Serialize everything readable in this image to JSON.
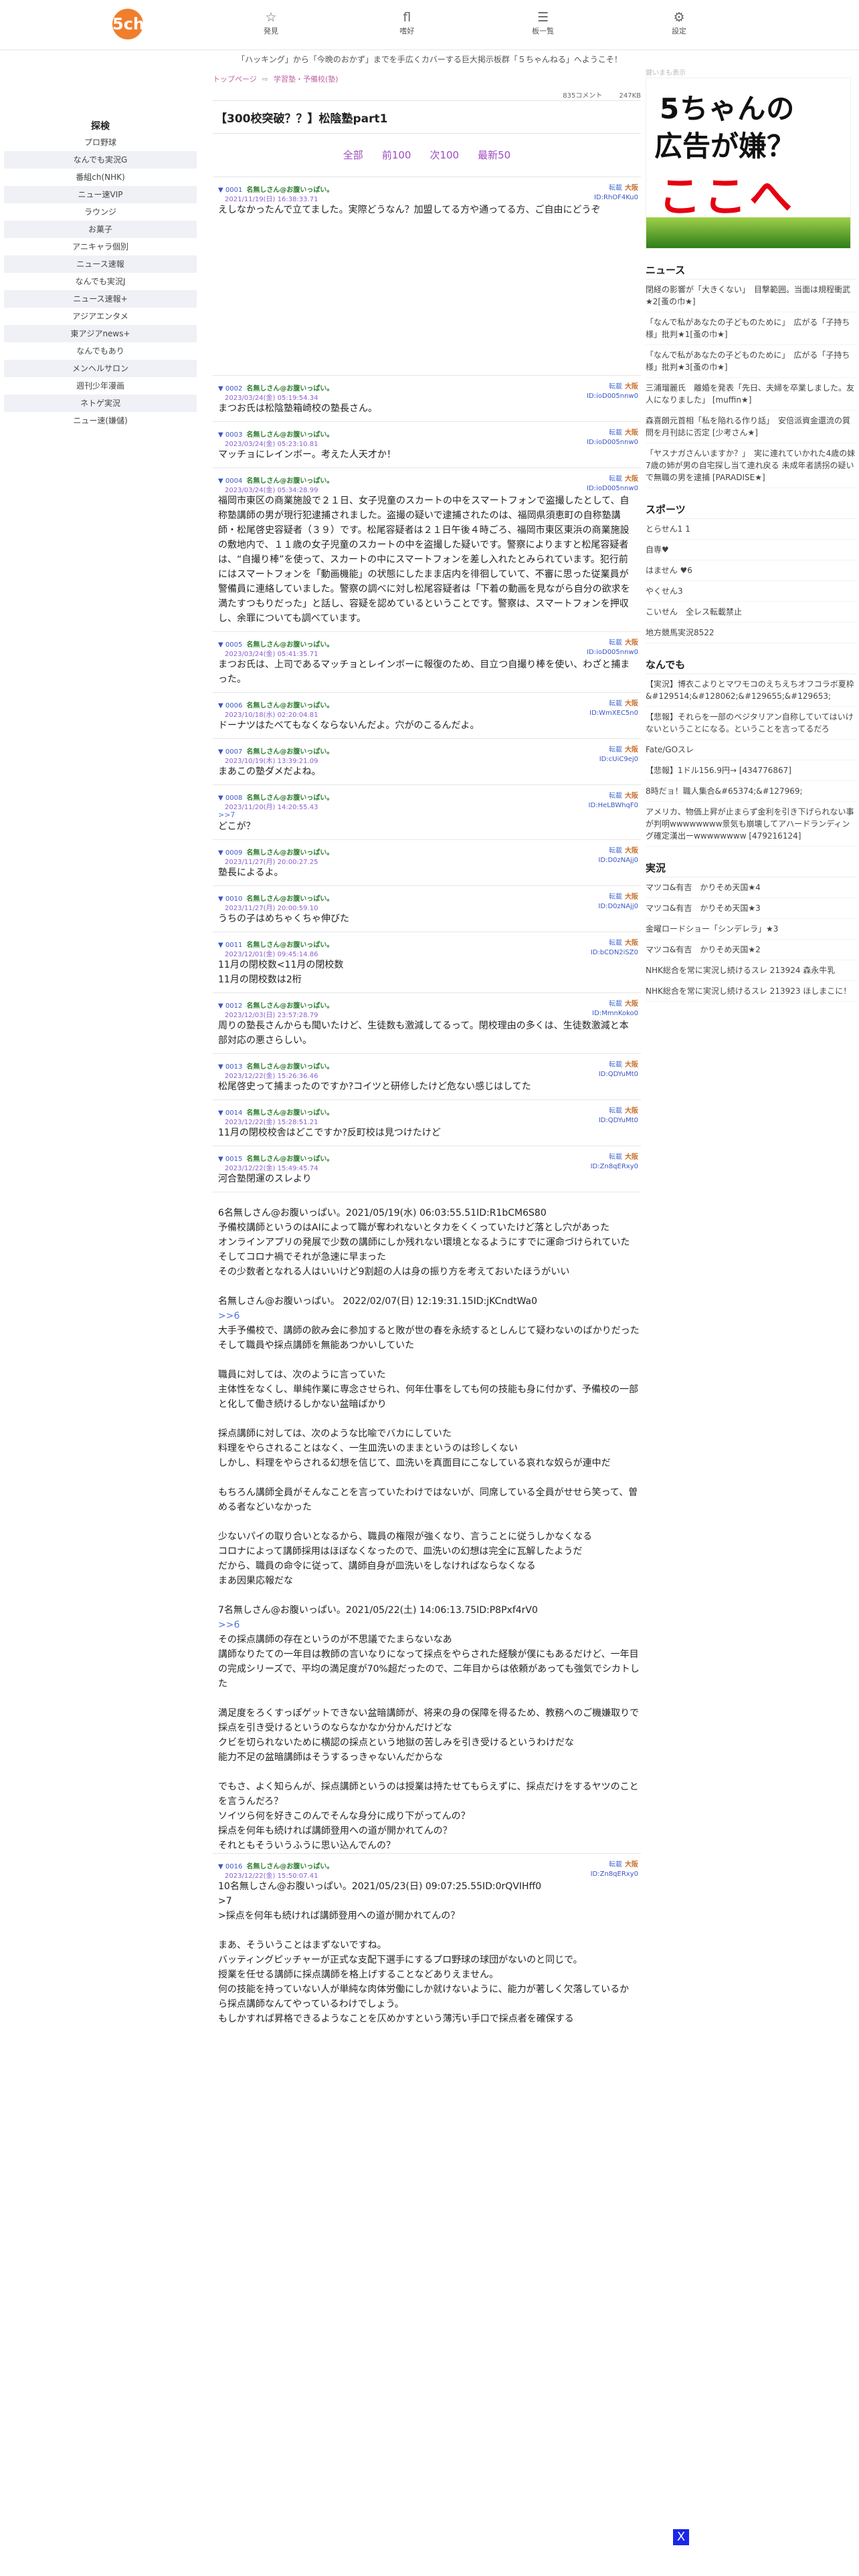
{
  "header": {
    "logo": "5ch",
    "nav": [
      {
        "icon": "☆",
        "label": "発見"
      },
      {
        "icon": "fl",
        "label": "嗜好"
      },
      {
        "icon": "☰",
        "label": "板一覧"
      },
      {
        "icon": "⚙",
        "label": "設定"
      }
    ],
    "ticker": "「ハッキング」から「今晩のおかず」までを手広くカバーする巨大掲示板群「５ちゃんねる」へようこそ！"
  },
  "leftbar": {
    "title": "探検",
    "items": [
      "プロ野球",
      "なんでも実況G",
      "番組ch(NHK)",
      "ニュー速VIP",
      "ラウンジ",
      "お菓子",
      "アニキャラ個別",
      "ニュース速報",
      "なんでも実況J",
      "ニュース速報+",
      "アジアエンタメ",
      "東アジアnews+",
      "なんでもあり",
      "メンヘルサロン",
      "週刊少年漫画",
      "ネトゲ実況",
      "ニュー速(嫌儲)"
    ]
  },
  "main": {
    "crumbs": [
      "トップページ",
      "学習塾・予備校(塾)"
    ],
    "meta": {
      "comments": "835コメント",
      "size": "247KB"
    },
    "title": "【300校突破？？】松陰塾part1",
    "pager": [
      "全部",
      "前100",
      "次100",
      "最新50"
    ],
    "posts": [
      {
        "num": "▼ 0001",
        "name": "名無しさん@お腹いっぱい。",
        "date": "2021/11/19(日) 16:38:33.71",
        "a": "転載",
        "b": "大阪",
        "id": "ID:RhOF4Ku0",
        "body": "えしなかったんで立てました。実際どうなん？加盟してる方や通ってる方、ご自由にどうぞ",
        "tall": true
      },
      {
        "num": "▼ 0002",
        "name": "名無しさん@お腹いっぱい。",
        "date": "2023/03/24(金) 05:19:54.34",
        "a": "転載",
        "b": "大阪",
        "id": "ID:ioD005nnw0",
        "body": "まつお氏は松陰塾箱崎校の塾長さん。"
      },
      {
        "num": "▼ 0003",
        "name": "名無しさん@お腹いっぱい。",
        "date": "2023/03/24(金) 05:23:10.81",
        "a": "転載",
        "b": "大阪",
        "id": "ID:ioD005nnw0",
        "body": "マッチョにレインボー。考えた人天才か！"
      },
      {
        "num": "▼ 0004",
        "name": "名無しさん@お腹いっぱい。",
        "date": "2023/03/24(金) 05:34:28.99",
        "a": "転載",
        "b": "大阪",
        "id": "ID:ioD005nnw0",
        "body": "福岡市東区の商業施設で２１日、女子児童のスカートの中をスマートフォンで盗撮したとして、自称塾講師の男が現行犯逮捕されました。盗撮の疑いで逮捕されたのは、福岡県須恵町の自称塾講師・松尾啓史容疑者（３９）です。松尾容疑者は２１日午後４時ごろ、福岡市東区東浜の商業施設の敷地内で、１１歳の女子児童のスカートの中を盗撮した疑いです。警察によりますと松尾容疑者は、“自撮り棒”を使って、スカートの中にスマートフォンを差し入れたとみられています。犯行前にはスマートフォンを「動画機能」の状態にしたまま店内を徘徊していて、不審に思った従業員が警備員に連絡していました。警察の調べに対し松尾容疑者は「下着の動画を見ながら自分の欲求を満たすつもりだった」と話し、容疑を認めているということです。警察は、スマートフォンを押収し、余罪についても調べています。"
      },
      {
        "num": "▼ 0005",
        "name": "名無しさん@お腹いっぱい。",
        "date": "2023/03/24(金) 05:41:35.71",
        "a": "転載",
        "b": "大阪",
        "id": "ID:ioD005nnw0",
        "body": "まつお氏は、上司であるマッチョとレインボーに報復のため、目立つ自撮り棒を使い、わざと捕まった。"
      },
      {
        "num": "▼ 0006",
        "name": "名無しさん@お腹いっぱい。",
        "date": "2023/10/18(水) 02:20:04.81",
        "a": "転載",
        "b": "大阪",
        "id": "ID:WmXEC5n0",
        "body": "ドーナツはたべてもなくならないんだよ。穴がのこるんだよ。"
      },
      {
        "num": "▼ 0007",
        "name": "名無しさん@お腹いっぱい。",
        "date": "2023/10/19(木) 13:39:21.09",
        "a": "転載",
        "b": "大阪",
        "id": "ID:cUiC9ej0",
        "body": "まあこの塾ダメだよね。"
      },
      {
        "num": "▼ 0008",
        "name": "名無しさん@お腹いっぱい。",
        "date": "2023/11/20(月) 14:20:55.43",
        "a": "転載",
        "b": "大阪",
        "id": "ID:HeLBWhqF0",
        "reply": ">>7",
        "body": "どこが？"
      },
      {
        "num": "▼ 0009",
        "name": "名無しさん@お腹いっぱい。",
        "date": "2023/11/27(月) 20:00:27.25",
        "a": "転載",
        "b": "大阪",
        "id": "ID:D0zNAjj0",
        "body": "塾長によるよ。"
      },
      {
        "num": "▼ 0010",
        "name": "名無しさん@お腹いっぱい。",
        "date": "2023/11/27(月) 20:00:59.10",
        "a": "転載",
        "b": "大阪",
        "id": "ID:D0zNAjj0",
        "body": "うちの子はめちゃくちゃ伸びた"
      },
      {
        "num": "▼ 0011",
        "name": "名無しさん@お腹いっぱい。",
        "date": "2023/12/01(金) 09:45:14.86",
        "a": "転載",
        "b": "大阪",
        "id": "ID:bCDN2iSZ0",
        "body": "11月の閉校数<11月の閉校数\n11月の閉校数は2桁"
      },
      {
        "num": "▼ 0012",
        "name": "名無しさん@お腹いっぱい。",
        "date": "2023/12/03(日) 23:57:28.79",
        "a": "転載",
        "b": "大阪",
        "id": "ID:MmnKoko0",
        "body": "周りの塾長さんからも聞いたけど、生徒数も激減してるって。閉校理由の多くは、生徒数激減と本部対応の悪さらしい。"
      },
      {
        "num": "▼ 0013",
        "name": "名無しさん@お腹いっぱい。",
        "date": "2023/12/22(金) 15:26:36.46",
        "a": "転載",
        "b": "大阪",
        "id": "ID:QDYuMt0",
        "body": "松尾啓史って捕まったのですか?コイツと研修したけど危ない感じはしてた"
      },
      {
        "num": "▼ 0014",
        "name": "名無しさん@お腹いっぱい。",
        "date": "2023/12/22(金) 15:28:51.21",
        "a": "転載",
        "b": "大阪",
        "id": "ID:QDYuMt0",
        "body": "11月の閉校校舎はどこですか?反町校は見つけたけど"
      },
      {
        "num": "▼ 0015",
        "name": "名無しさん@お腹いっぱい。",
        "date": "2023/12/22(金) 15:49:45.74",
        "a": "転載",
        "b": "大阪",
        "id": "ID:Zn8qERxy0",
        "body": "河合塾閉運のスレより"
      }
    ],
    "longblock": [
      {
        "type": "text",
        "text": "6名無しさん@お腹いっぱい。2021/05/19(水) 06:03:55.51ID:R1bCM6S80\n予備校講師というのはAIによって職が奪われないとタカをくくっていたけど落とし穴があった\nオンラインアプリの発展で少数の講師にしか残れない環境となるようにすでに運命づけられていた\nそしてコロナ禍でそれが急速に早まった\nその少数者となれる人はいいけど9割超の人は身の振り方を考えておいたほうがいい\n\n名無しさん@お腹いっぱい。 2022/02/07(日) 12:19:31.15ID:jKCndtWa0"
      },
      {
        "type": "link",
        "text": ">>6"
      },
      {
        "type": "text",
        "text": "大手予備校で、講師の飲み会に参加すると敗が世の春を永続するとしんじて疑わないのばかりだった\nそして職員や採点講師を無能あつかいしていた\n\n職員に対しては、次のように言っていた\n主体性をなくし、単純作業に専念させられ、何年仕事をしても何の技能も身に付かず、予備校の一部と化して働き続けるしかない盆暗ばかり\n\n採点講師に対しては、次のような比喩でバカにしていた\n料理をやらされることはなく、一生皿洗いのままというのは珍しくない\nしかし、料理をやらされる幻想を信じて、皿洗いを真面目にこなしている哀れな奴らが連中だ\n\nもちろん講師全員がそんなことを言っていたわけではないが、同席している全員がせせら笑って、曽める者などいなかった\n\n少ないパイの取り合いとなるから、職員の権限が強くなり、言うことに従うしかなくなる\nコロナによって講師採用はほぼなくなったので、皿洗いの幻想は完全に瓦解したようだ\nだから、職員の命令に従って、講師自身が皿洗いをしなければならなくなる\nまあ因果応報だな\n\n7名無しさん@お腹いっぱい。2021/05/22(土) 14:06:13.75ID:P8Pxf4rV0"
      },
      {
        "type": "link",
        "text": ">>6"
      },
      {
        "type": "text",
        "text": "その採点講師の存在というのが不思議でたまらないなあ\n講師なりたての一年目は教師の言いなりになって採点をやらされた経験が僕にもあるだけど、一年目の完成シリーズで、平均の満足度が70%超だったので、二年目からは依頼があっても強気でシカトした\n\n満足度をろくすっぽゲットできない盆暗講師が、将来の身の保障を得るため、教務へのご機嫌取りで採点を引き受けるというのならなかなか分かんだけどな\nクビを切られないために横認の採点という地獄の苦しみを引き受けるというわけだな\n能力不足の盆暗講師はそうするっきゃないんだからな\n\nでもさ、よく知らんが、採点講師というのは授業は持たせてもらえずに、採点だけをするヤツのことを言うんだろ？\nソイツら何を好きこのんでそんな身分に成り下がってんの？\n採点を何年も続ければ講師登用への道が開かれてんの？\nそれともそういうふうに思い込んでんの？"
      }
    ],
    "post16": {
      "num": "▼ 0016",
      "name": "名無しさん@お腹いっぱい。",
      "date": "2023/12/22(金) 15:50:07.41",
      "a": "転載",
      "b": "大阪",
      "id": "ID:Zn8qERxy0",
      "body": "10名無しさん@お腹いっぱい。2021/05/23(日) 09:07:25.55ID:0rQVIHff0\n>7\n>採点を何年も続ければ講師登用への道が開かれてんの？\n\nまあ、そういうことはまずないですね。\nバッティングピッチャーが正式な支配下選手にするプロ野球の球団がないのと同じで。\n授業を任せる講師に採点講師を格上げすることなどありえません。\n何の技能を持っていない人が単純な肉体労働にしか就けないように、能力が著しく欠落しているから採点講師なんてやっているわけでしょう。\nもしかすれば昇格できるようなことを仄めかすという薄汚い手口で採点者を確保する"
    }
  },
  "rightbar": {
    "ad_label": "鍵いまも表示",
    "ad": {
      "line1": "5ちゃんの",
      "line2": "広告が嫌？",
      "line3": "ここへ"
    },
    "sections": [
      {
        "title": "ニュース",
        "items": [
          "閉経の影響が「大きくない」　目撃範囲。当面は規程衝武★2[蚤の巾★]",
          "「なんで私があなたの子どものために」　広がる「子持ち様」批判★1[蚤の巾★]",
          "「なんで私があなたの子どものために」　広がる「子持ち様」批判★3[蚤の巾★]",
          "三浦瑠麗氏　離婚を発表「先日、夫婦を卒業しました。友人になりました」 [muffin★]",
          "森喜朗元首相「私を陥れる作り話」　安倍派資金還流の質問を月刊誌に否定 [少考さん★]",
          "「ヤスナガさんいますか？」　実に連れていかれた4歳の妹　7歳の姉が男の自宅探し当て連れ戻る 未成年者誘拐の疑いで無職の男を逮捕 [PARADISE★]"
        ]
      },
      {
        "title": "スポーツ",
        "items": [
          "とらせん1 1",
          "自専♥",
          "はません ♥6",
          "やくせん3",
          "こいせん　全レス転載禁止",
          "地方競馬実況8522"
        ]
      },
      {
        "title": "なんでも",
        "items": [
          "【実況】博衣こよりとマワモコのえちえちオフコラボ夏枠 &#129514;&#128062;&#129655;&#129653;",
          "【悲報】それらを一部のベジタリアン自称していてはいけないということになる。ということを言ってるだろ",
          "Fate/GOスレ",
          "【悲報】1ドル156.9円→ [434776867]",
          "8時だョ！職人集合&#65374;&#127969;",
          "アメリカ、物価上昇が止まらず金利を引き下げられない事が判明wwwwwwww景気も崩壊してアハードランディング確定漢出ーwwwwwwww [479216124]"
        ]
      },
      {
        "title": "実況",
        "items": [
          "マツコ&有吉　かりそめ天国★4",
          "マツコ&有吉　かりそめ天国★3",
          "金曜ロードショー「シンデレラ」★3",
          "マツコ&有吉　かりそめ天国★2",
          "NHK総合を常に実況し続けるスレ 213924 森永牛乳",
          "NHK総合を常に実況し続けるスレ 213923 ほしまこに！"
        ]
      }
    ]
  },
  "x_button": "X"
}
